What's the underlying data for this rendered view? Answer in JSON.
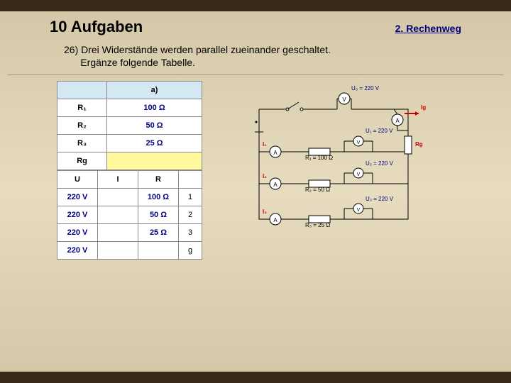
{
  "header": {
    "title": "10 Aufgaben",
    "link": "2. Rechenweg"
  },
  "problem": {
    "num": "26)",
    "text1": "Drei Widerstände werden parallel zueinander geschaltet.",
    "text2": "Ergänze folgende Tabelle."
  },
  "table1": {
    "hdr": [
      "",
      "a)"
    ],
    "rows": [
      {
        "label": "R₁",
        "val": "100 Ω",
        "cls": ""
      },
      {
        "label": "R₂",
        "val": "50 Ω",
        "cls": ""
      },
      {
        "label": "R₃",
        "val": "25 Ω",
        "cls": ""
      },
      {
        "label": "Rg",
        "val": "",
        "cls": "yellow"
      }
    ]
  },
  "table2": {
    "hdr": [
      "U",
      "I",
      "R",
      ""
    ],
    "rows": [
      {
        "u": "220 V",
        "i": "",
        "r": "100 Ω",
        "n": "1"
      },
      {
        "u": "220 V",
        "i": "",
        "r": "50 Ω",
        "n": "2"
      },
      {
        "u": "220 V",
        "i": "",
        "r": "25 Ω",
        "n": "3"
      },
      {
        "u": "220 V",
        "i": "",
        "r": "",
        "n": "g"
      }
    ]
  },
  "circuit": {
    "u0": "U₀ = 220 V",
    "ig": "Ig",
    "u1": "U₁ = 220 V",
    "u2": "U₂ = 220 V",
    "u3": "U₃ = 220 V",
    "r1": "R₁ = 100 Ω",
    "r2": "R₂ = 50 Ω",
    "r3": "R₃ = 25 Ω",
    "rg": "Rg",
    "i1": "I₁",
    "i2": "I₂",
    "i3": "I₃"
  }
}
